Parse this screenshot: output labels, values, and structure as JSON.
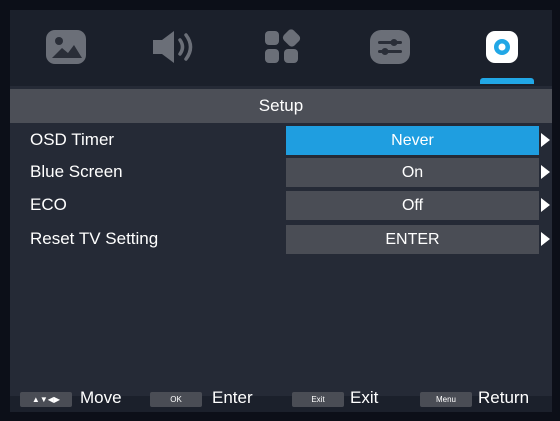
{
  "tabs": [
    {
      "name": "picture",
      "icon": "picture-icon"
    },
    {
      "name": "sound",
      "icon": "speaker-icon"
    },
    {
      "name": "channel",
      "icon": "channel-grid-icon"
    },
    {
      "name": "function",
      "icon": "sliders-icon"
    },
    {
      "name": "setup",
      "icon": "gear-icon",
      "active": true
    }
  ],
  "menu": {
    "title": "Setup",
    "items": [
      {
        "label": "OSD Timer",
        "value": "Never",
        "selected": true
      },
      {
        "label": "Blue Screen",
        "value": "On"
      },
      {
        "label": "ECO",
        "value": "Off"
      },
      {
        "label": "Reset TV Setting",
        "value": "ENTER"
      }
    ]
  },
  "hints": [
    {
      "key": "▲▼◀▶",
      "label": "Move"
    },
    {
      "key": "OK",
      "label": "Enter"
    },
    {
      "key": "Exit",
      "label": "Exit"
    },
    {
      "key": "Menu",
      "label": "Return"
    }
  ],
  "colors": {
    "accent": "#1f9ee0",
    "background": "#252a36",
    "value_box": "#4a4d55",
    "title_bar": "#4c4f57"
  }
}
